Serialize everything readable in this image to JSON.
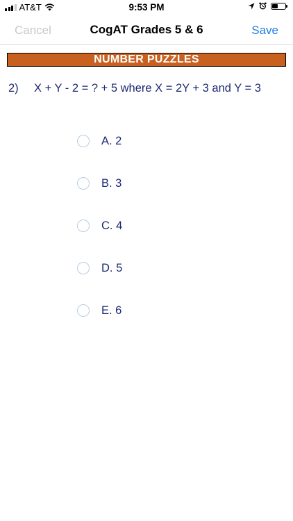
{
  "status": {
    "carrier": "AT&T",
    "time": "9:53 PM",
    "battery_level": 0.45,
    "icons": [
      "signal-icon",
      "wifi-icon",
      "location-icon",
      "alarm-icon",
      "battery-icon"
    ]
  },
  "nav": {
    "cancel_label": "Cancel",
    "title": "CogAT Grades 5 & 6",
    "save_label": "Save"
  },
  "section": {
    "title": "NUMBER PUZZLES"
  },
  "question": {
    "number": "2)",
    "text": "X + Y - 2 = ? + 5 where X = 2Y + 3 and Y = 3"
  },
  "options": [
    {
      "label": "A. 2"
    },
    {
      "label": "B. 3"
    },
    {
      "label": "C. 4"
    },
    {
      "label": "D. 5"
    },
    {
      "label": "E. 6"
    }
  ],
  "colors": {
    "banner": "#c8601f",
    "question_text": "#1d2a72",
    "save": "#1e7ee0",
    "cancel_disabled": "#c8c8c8"
  }
}
